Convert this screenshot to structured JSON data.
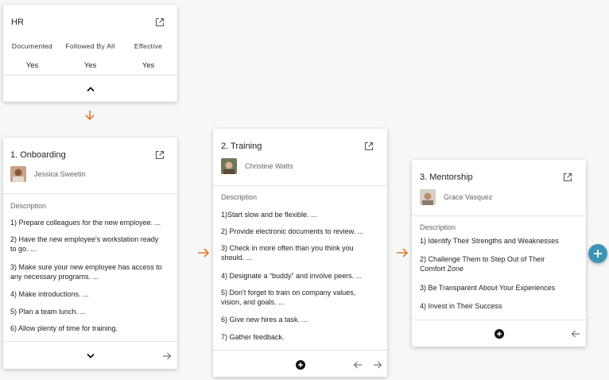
{
  "hr": {
    "title": "HR",
    "columns": [
      {
        "label": "Documented",
        "value": "Yes"
      },
      {
        "label": "Followed By All",
        "value": "Yes"
      },
      {
        "label": "Effective",
        "value": "Yes"
      }
    ]
  },
  "steps": [
    {
      "title": "1. Onboarding",
      "person": "Jessica Sweetin",
      "description_label": "Description",
      "items": [
        "1) Prepare colleagues for the new employee. ...",
        "2) Have the new employee's workstation ready to go. ...",
        "3) Make sure your new employee has access to any necessary programs. ...",
        "4) Make introductions. ...",
        "5) Plan a team lunch. ...",
        "6) Allow plenty of time for training."
      ]
    },
    {
      "title": "2. Training",
      "person": "Christine Watts",
      "description_label": "Description",
      "items": [
        "1)Start slow and be flexible. ...",
        "2) Provide electronic documents to review. ...",
        "3) Check in more often than you think you should. ...",
        "4) Designate a “buddy” and involve peers. ...",
        "5) Don't forget to train on company values, vision, and goals. ...",
        "6) Give new hires a task. ...",
        "7) Gather feedback."
      ]
    },
    {
      "title": "3. Mentorship",
      "person": "Grace Vasquez",
      "description_label": "Description",
      "items": [
        "1) Identify Their Strengths and Weaknesses",
        "2) Challenge Them to Step Out of Their Comfort Zone",
        "3) Be Transparent About Your Experiences",
        "4) Invest in Their Success"
      ]
    }
  ],
  "colors": {
    "accent_arrow": "#e07b2a",
    "fab": "#3d93b5"
  },
  "icons": [
    "external-link-icon",
    "chevron-up-icon",
    "chevron-down-icon",
    "arrow-down-icon",
    "arrow-right-icon",
    "arrow-left-icon",
    "add-circle-icon",
    "plus-icon"
  ]
}
